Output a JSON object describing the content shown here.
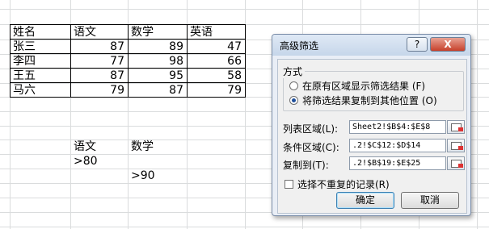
{
  "sheet": {
    "table": {
      "headers": [
        "姓名",
        "语文",
        "数学",
        "英语"
      ],
      "rows": [
        [
          "张三",
          "87",
          "89",
          "47"
        ],
        [
          "李四",
          "77",
          "98",
          "66"
        ],
        [
          "王五",
          "87",
          "95",
          "58"
        ],
        [
          "马六",
          "79",
          "87",
          "79"
        ]
      ]
    },
    "criteria": {
      "headers": [
        "语文",
        "数学"
      ],
      "row1": [
        ">80",
        ""
      ],
      "row2": [
        "",
        ">90"
      ]
    }
  },
  "dialog": {
    "title": "高级筛选",
    "help_label": "?",
    "close_label": "X",
    "method_label": "方式",
    "radio_in_place": "在原有区域显示筛选结果 (F)",
    "radio_copy": "将筛选结果复制到其他位置 (O)",
    "list_range_label": "列表区域(L):",
    "list_range_value": "Sheet2!$B$4:$E$8",
    "criteria_range_label": "条件区域(C):",
    "criteria_range_value": ".2!$C$12:$D$14",
    "copy_to_label": "复制到(T):",
    "copy_to_value": ".2!$B$19:$E$25",
    "unique_label": "选择不重复的记录(R)",
    "ok_label": "确定",
    "cancel_label": "取消"
  }
}
